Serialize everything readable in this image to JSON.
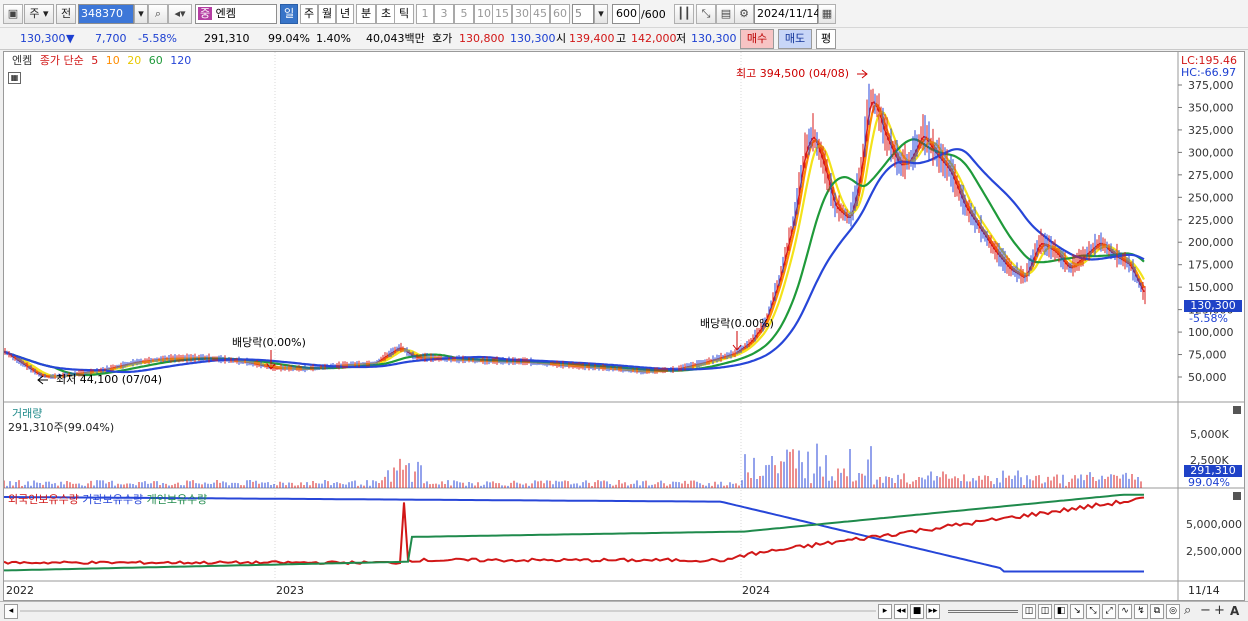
{
  "toolbar": {
    "stock_type": "주",
    "prev_label": "전",
    "code_value": "348370",
    "stock_badge": "중",
    "stock_name": "엔켐",
    "periods": [
      "일",
      "주",
      "월",
      "년",
      "분",
      "초",
      "틱"
    ],
    "active_period": "일",
    "intervals": [
      "1",
      "3",
      "5",
      "10",
      "15",
      "30",
      "45",
      "60"
    ],
    "interval_value": "5",
    "count_value": "600",
    "count_total": "/600",
    "date_value": "2024/11/14"
  },
  "quote": {
    "price": "130,300",
    "down_arrow": "▼",
    "change": "7,700",
    "change_pct": "-5.58%",
    "volume": "291,310",
    "vol_ratio": "99.04%",
    "turnover": "1.40%",
    "amount": "40,043백만",
    "hoga_label": "호가",
    "ask": "130,800",
    "bid": "130,300",
    "open_label": "시",
    "open": "139,400",
    "high_label": "고",
    "high": "142,000",
    "low_label": "저",
    "low": "130,300",
    "buy_label": "매수",
    "sell_label": "매도",
    "eval_label": "평"
  },
  "legend": {
    "name": "엔켐",
    "desc": "종가 단순",
    "ma5": "5",
    "ma10": "10",
    "ma20": "20",
    "ma60": "60",
    "ma120": "120"
  },
  "chart_data": [
    {
      "type": "line",
      "title": "엔켐",
      "x": [
        "2022-07-04",
        "2023",
        "2024-04-08",
        "2024-11-14"
      ],
      "ylabel": "",
      "ylim": [
        30000,
        410000
      ],
      "yticks": [
        "375,000",
        "350,000",
        "325,000",
        "300,000",
        "275,000",
        "250,000",
        "225,000",
        "200,000",
        "175,000",
        "150,000",
        "125,000",
        "100,000",
        "75,000",
        "50,000"
      ],
      "annotations": {
        "high": "최고 394,500 (04/08)",
        "low": "최저 44,100 (07/04)",
        "dividend1": "배당락(0.00%)",
        "dividend2": "배당락(0.00%)",
        "lc": "LC:195.46",
        "hc": "HC:-66.97",
        "last_price": "130,300",
        "last_pct": "-5.58%"
      },
      "series": [
        {
          "name": "5",
          "color": "#d81b1b"
        },
        {
          "name": "10",
          "color": "#ff8c00"
        },
        {
          "name": "20",
          "color": "#f3e31a"
        },
        {
          "name": "60",
          "color": "#1f9a3a"
        },
        {
          "name": "120",
          "color": "#2746d8"
        }
      ]
    },
    {
      "type": "bar",
      "title": "거래량",
      "subtitle": "291,310주(99.04%)",
      "yticks": [
        "5,000K",
        "2,500K"
      ],
      "last_value": "291,310",
      "last_pct": "99.04%"
    },
    {
      "type": "line",
      "series": [
        {
          "name": "외국인보유수량",
          "color": "#d11717"
        },
        {
          "name": "기관보유수량",
          "color": "#2746d8"
        },
        {
          "name": "개인보유수량",
          "color": "#1f8a4c"
        }
      ],
      "yticks": [
        "5,000,000",
        "2,500,000"
      ]
    }
  ],
  "xaxis": {
    "labels": [
      "2022",
      "2023",
      "2024"
    ],
    "end_label": "11/14"
  }
}
